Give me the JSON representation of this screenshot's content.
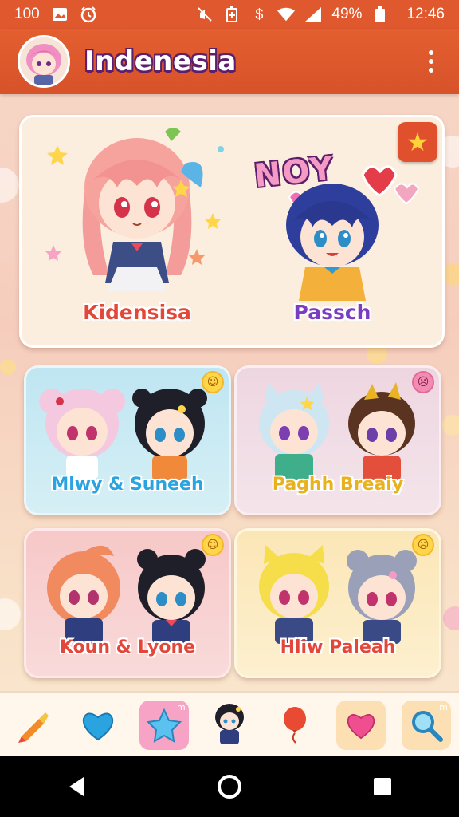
{
  "status_bar": {
    "left_number": "100",
    "battery_percent": "49%",
    "time": "12:46",
    "icons": [
      "image-icon",
      "alarm-icon",
      "mute-icon",
      "battery-saver-icon",
      "dollar-icon",
      "wifi-icon",
      "signal-icon",
      "battery-icon"
    ]
  },
  "app_bar": {
    "title": "Indenesia",
    "avatar_icon": "avatar-icon",
    "menu_icon": "more-vert-icon"
  },
  "featured_card": {
    "left_name": "Kidensisa",
    "right_name": "Passch",
    "banner_text": "NOY",
    "favorite_icon": "star-icon"
  },
  "cards": [
    {
      "name": "Mlwy & Suneeh",
      "name_color": "#2aa4e0",
      "badge_icon": "smile-icon"
    },
    {
      "name": "Paghh Breaiy",
      "name_color": "#e8b21f",
      "badge_icon": "smile-icon"
    },
    {
      "name": "Koun & Lyone",
      "name_color": "#e2473a",
      "badge_icon": "smile-icon"
    },
    {
      "name": "Hliw Paleah",
      "name_color": "#e2473a",
      "badge_icon": "smile-icon"
    }
  ],
  "toolbar": {
    "items": [
      {
        "icon": "crayon-icon",
        "label": ""
      },
      {
        "icon": "heart-blue-icon",
        "label": ""
      },
      {
        "icon": "star-icon",
        "label": "m",
        "selected": true
      },
      {
        "icon": "character-icon",
        "label": ""
      },
      {
        "icon": "balloon-icon",
        "label": ""
      },
      {
        "icon": "heart-pink-icon",
        "label": ""
      },
      {
        "icon": "search-icon",
        "label": "m"
      }
    ]
  },
  "nav_bar": {
    "icons": [
      "back-icon",
      "home-icon",
      "recents-icon"
    ]
  },
  "colors": {
    "accent": "#e0582e",
    "title_outline": "#5b1f6b",
    "feature_left_name": "#e2473a",
    "feature_right_name": "#7a3cc0"
  }
}
